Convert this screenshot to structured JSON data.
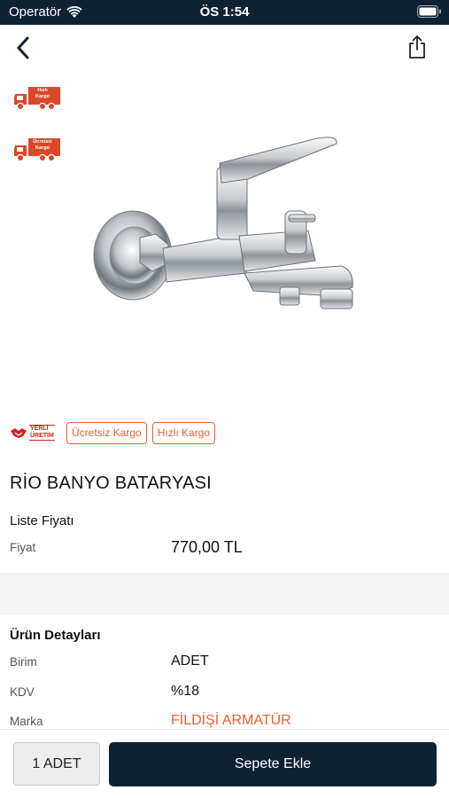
{
  "status_bar": {
    "carrier": "Operatör",
    "time": "ÖS 1:54"
  },
  "nav": {
    "back_icon": "chevron-left-icon",
    "share_icon": "share-icon"
  },
  "shipping_icons": [
    {
      "text": "Hızlı Kargo"
    },
    {
      "text": "Ücretsiz Kargo"
    }
  ],
  "badges": {
    "yerli_line1": "YERLİ",
    "yerli_line2": "ÜRETİM",
    "tags": [
      "Ücretsiz Kargo",
      "Hızlı Kargo"
    ]
  },
  "product": {
    "title": "RİO BANYO BATARYASI",
    "price_heading": "Liste Fiyatı",
    "price_label": "Fiyat",
    "price_value": "770,00 TL"
  },
  "details": {
    "heading": "Ürün Detayları",
    "rows": [
      {
        "label": "Birim",
        "value": "ADET"
      },
      {
        "label": "KDV",
        "value": "%18"
      },
      {
        "label": "Marka",
        "value": "FİLDİŞİ ARMATÜR"
      }
    ]
  },
  "bottom": {
    "quantity": "1 ADET",
    "add_to_cart": "Sepete Ekle"
  },
  "colors": {
    "navy": "#0f2233",
    "accent_orange": "#e8602c",
    "brand_link": "#e8602c",
    "badge_red": "#d32020"
  }
}
